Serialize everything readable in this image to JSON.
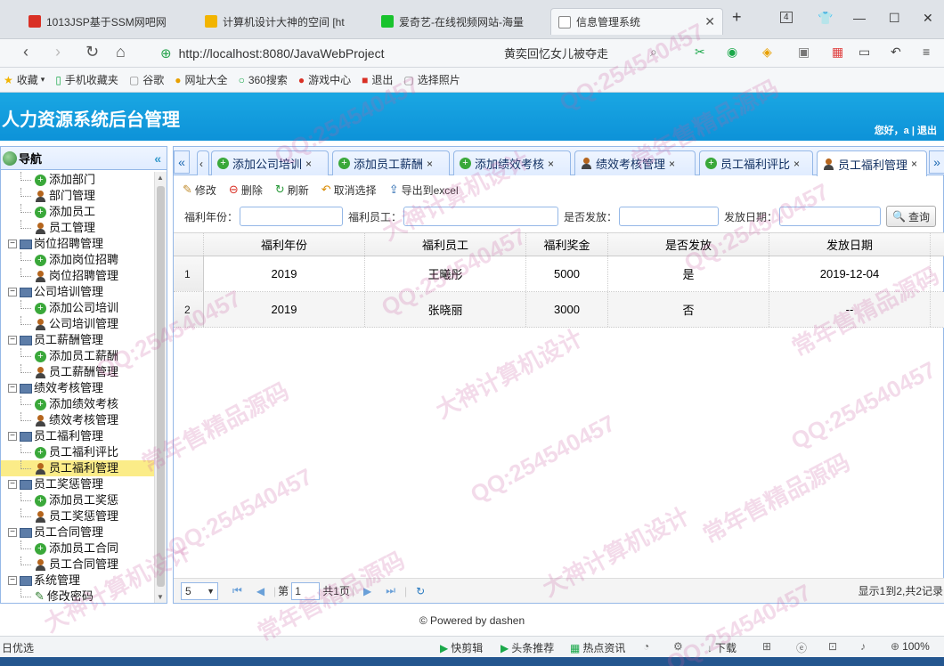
{
  "browser": {
    "tabs": [
      {
        "title": "1013JSP基于SSM网吧网",
        "color": "#d93025"
      },
      {
        "title": "计算机设计大神的空间 [ht",
        "color": "#f2b400"
      },
      {
        "title": "爱奇艺-在线视频网站-海量",
        "color": "#19c32d"
      },
      {
        "title": "信息管理系统",
        "color": "#888888"
      }
    ],
    "new_tab": "+",
    "tab_count": "4",
    "url": "http://localhost:8080/JavaWebProject",
    "hot_search": "黄奕回忆女儿被夺走",
    "bookmarks": [
      "收藏",
      "手机收藏夹",
      "谷歌",
      "网址大全",
      "360搜索",
      "游戏中心",
      "退出",
      "选择照片"
    ],
    "status_left": "日优选",
    "status_items": [
      "快剪辑",
      "头条推荐",
      "热点资讯",
      "下载",
      "100%"
    ]
  },
  "app": {
    "title": "人力资源系统后台管理",
    "user_info": "您好，a | 退出"
  },
  "sidebar": {
    "title": "导航",
    "collapse": "«",
    "items": [
      {
        "label": "添加部门",
        "kind": "add"
      },
      {
        "label": "部门管理",
        "kind": "user"
      },
      {
        "label": "添加员工",
        "kind": "add"
      },
      {
        "label": "员工管理",
        "kind": "user"
      },
      {
        "label": "岗位招聘管理",
        "kind": "folder"
      },
      {
        "label": "添加岗位招聘",
        "kind": "add"
      },
      {
        "label": "岗位招聘管理",
        "kind": "user"
      },
      {
        "label": "公司培训管理",
        "kind": "folder"
      },
      {
        "label": "添加公司培训",
        "kind": "add"
      },
      {
        "label": "公司培训管理",
        "kind": "user"
      },
      {
        "label": "员工薪酬管理",
        "kind": "folder"
      },
      {
        "label": "添加员工薪酬",
        "kind": "add"
      },
      {
        "label": "员工薪酬管理",
        "kind": "user"
      },
      {
        "label": "绩效考核管理",
        "kind": "folder"
      },
      {
        "label": "添加绩效考核",
        "kind": "add"
      },
      {
        "label": "绩效考核管理",
        "kind": "user"
      },
      {
        "label": "员工福利管理",
        "kind": "folder"
      },
      {
        "label": "员工福利评比",
        "kind": "add"
      },
      {
        "label": "员工福利管理",
        "kind": "user"
      },
      {
        "label": "员工奖惩管理",
        "kind": "folder"
      },
      {
        "label": "添加员工奖惩",
        "kind": "add"
      },
      {
        "label": "员工奖惩管理",
        "kind": "user"
      },
      {
        "label": "员工合同管理",
        "kind": "folder"
      },
      {
        "label": "添加员工合同",
        "kind": "add"
      },
      {
        "label": "员工合同管理",
        "kind": "user"
      },
      {
        "label": "系统管理",
        "kind": "folder"
      },
      {
        "label": "修改密码",
        "kind": "pen"
      }
    ]
  },
  "tabs": [
    {
      "label": "添加公司培训",
      "kind": "add"
    },
    {
      "label": "添加员工薪酬",
      "kind": "add"
    },
    {
      "label": "添加绩效考核",
      "kind": "add"
    },
    {
      "label": "绩效考核管理",
      "kind": "user"
    },
    {
      "label": "员工福利评比",
      "kind": "add"
    },
    {
      "label": "员工福利管理",
      "kind": "user"
    }
  ],
  "toolbar": {
    "edit": "修改",
    "delete": "删除",
    "refresh": "刷新",
    "unselect": "取消选择",
    "export": "导出到excel"
  },
  "search": {
    "year_label": "福利年份：",
    "employee_label": "福利员工：",
    "issued_label": "是否发放：",
    "date_label": "发放日期：",
    "query": "查询"
  },
  "grid": {
    "columns": [
      "福利年份",
      "福利员工",
      "福利奖金",
      "是否发放",
      "发放日期"
    ],
    "rows": [
      [
        "1",
        "2019",
        "王曦彤",
        "5000",
        "是",
        "2019-12-04"
      ],
      [
        "2",
        "2019",
        "张晓丽",
        "3000",
        "否",
        "--"
      ]
    ]
  },
  "pager": {
    "page_size": "5",
    "page_prefix": "第",
    "page_value": "1",
    "page_total": "共1页",
    "info": "显示1到2,共2记录"
  },
  "footer": "© Powered by dashen",
  "watermarks": [
    "QQ:254540457",
    "常年售精品源码",
    "大神计算机设计"
  ]
}
